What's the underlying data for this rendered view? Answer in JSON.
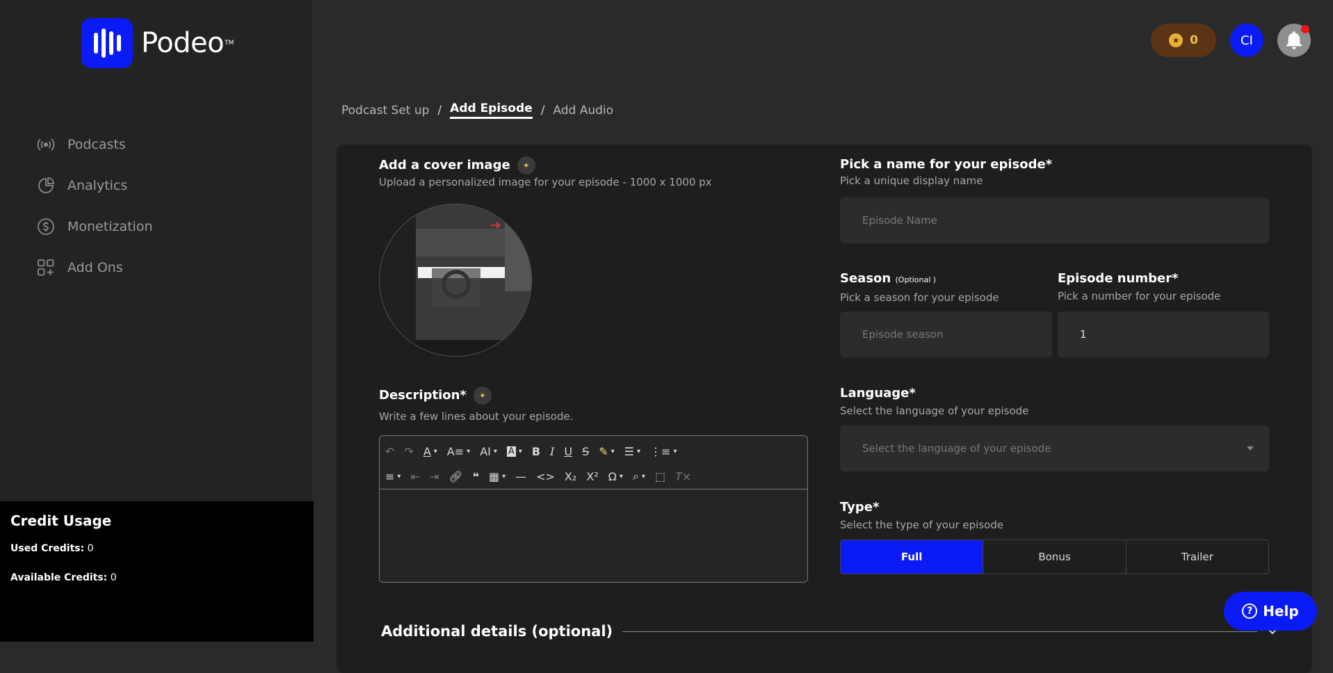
{
  "brand": {
    "name": "Podeo",
    "tm": "TM"
  },
  "sidebar": {
    "items": [
      {
        "label": "Podcasts",
        "icon": "broadcast-icon"
      },
      {
        "label": "Analytics",
        "icon": "pie-chart-icon"
      },
      {
        "label": "Monetization",
        "icon": "dollar-icon"
      },
      {
        "label": "Add Ons",
        "icon": "grid-plus-icon"
      }
    ]
  },
  "credit_usage": {
    "title": "Credit Usage",
    "used_label": "Used Credits:",
    "used_value": "0",
    "available_label": "Available Credits:",
    "available_value": "0"
  },
  "header": {
    "credits": "0",
    "avatar_initials": "CI"
  },
  "breadcrumb": {
    "step1": "Podcast Set up",
    "sep": "/",
    "step2": "Add Episode",
    "step3": "Add Audio"
  },
  "cover": {
    "label": "Add a cover image",
    "sub": "Upload a personalized image for your episode - 1000 x 1000 px"
  },
  "episode_name": {
    "label": "Pick a name for your episode*",
    "sub": "Pick a unique display name",
    "placeholder": "Episode Name"
  },
  "season": {
    "label": "Season",
    "optional": "(Optional )",
    "sub": "Pick a season for your episode",
    "placeholder": "Episode season"
  },
  "episode_number": {
    "label": "Episode number*",
    "sub": "Pick a number for your episode",
    "value": "1"
  },
  "description": {
    "label": "Description*",
    "sub": "Write a few lines about your episode."
  },
  "language": {
    "label": "Language*",
    "sub": "Select the language of your episode",
    "placeholder": "Select the language of your episode"
  },
  "type": {
    "label": "Type*",
    "sub": "Select the type of your episode",
    "options": [
      "Full",
      "Bonus",
      "Trailer"
    ],
    "selected": "Full"
  },
  "additional": {
    "label": "Additional details (optional)"
  },
  "help": {
    "label": "Help"
  },
  "colors": {
    "accent": "#0a1bf5",
    "credits_bg": "#5a3414",
    "notification": "#f01515"
  }
}
